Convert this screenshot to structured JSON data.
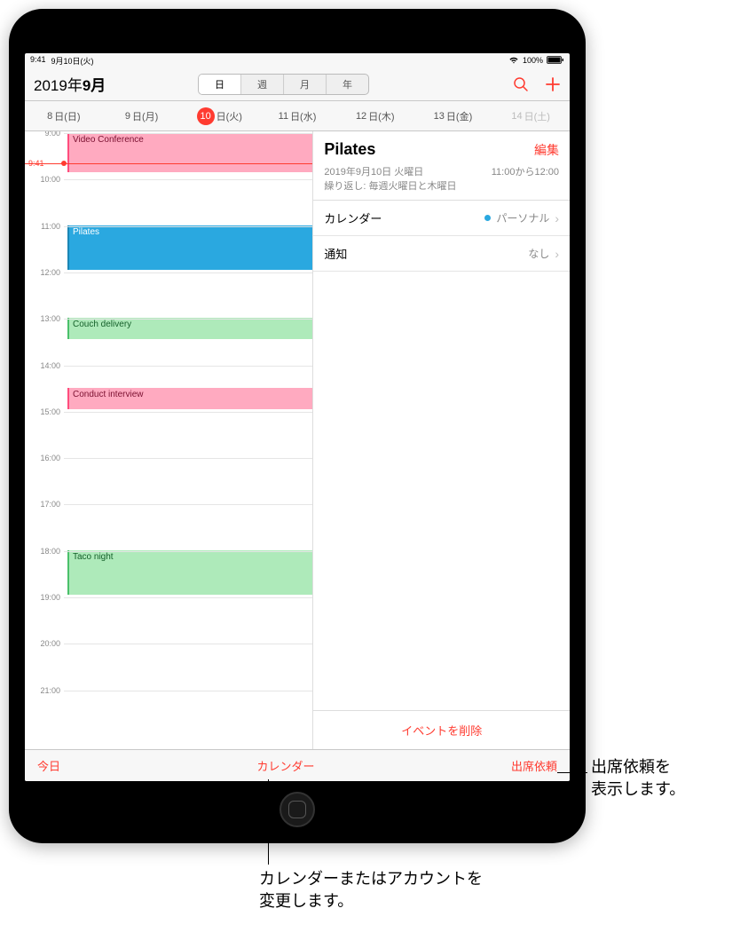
{
  "status": {
    "time": "9:41",
    "date": "9月10日(火)",
    "battery": "100%"
  },
  "nav": {
    "title_prefix": "2019年",
    "title_month": "9月",
    "segments": {
      "day": "日",
      "week": "週",
      "month": "月",
      "year": "年"
    }
  },
  "week": {
    "days": [
      {
        "num": "8",
        "dow": "日(日)"
      },
      {
        "num": "9",
        "dow": "日(月)"
      },
      {
        "num": "10",
        "dow": "日(火)",
        "selected": true
      },
      {
        "num": "11",
        "dow": "日(水)"
      },
      {
        "num": "12",
        "dow": "日(木)"
      },
      {
        "num": "13",
        "dow": "日(金)"
      },
      {
        "num": "14",
        "dow": "日(土)",
        "faded": true
      }
    ]
  },
  "timeline": {
    "hours": [
      "9:00",
      "10:00",
      "11:00",
      "12:00",
      "13:00",
      "14:00",
      "15:00",
      "16:00",
      "17:00",
      "18:00",
      "19:00",
      "20:00",
      "21:00"
    ],
    "now_label": "9:41",
    "events": {
      "video": "Video Conference",
      "pilates": "Pilates",
      "couch": "Couch delivery",
      "interview": "Conduct interview",
      "taco": "Taco night"
    }
  },
  "detail": {
    "title": "Pilates",
    "edit": "編集",
    "date": "2019年9月10日 火曜日",
    "time": "11:00から12:00",
    "repeat": "繰り返し: 毎週火曜日と木曜日",
    "calendar_label": "カレンダー",
    "calendar_value": "パーソナル",
    "alert_label": "通知",
    "alert_value": "なし",
    "delete": "イベントを削除"
  },
  "toolbar": {
    "today": "今日",
    "calendars": "カレンダー",
    "inbox": "出席依頼"
  },
  "callouts": {
    "inbox": "出席依頼を\n表示します。",
    "calendars": "カレンダーまたはアカウントを\n変更します。"
  }
}
